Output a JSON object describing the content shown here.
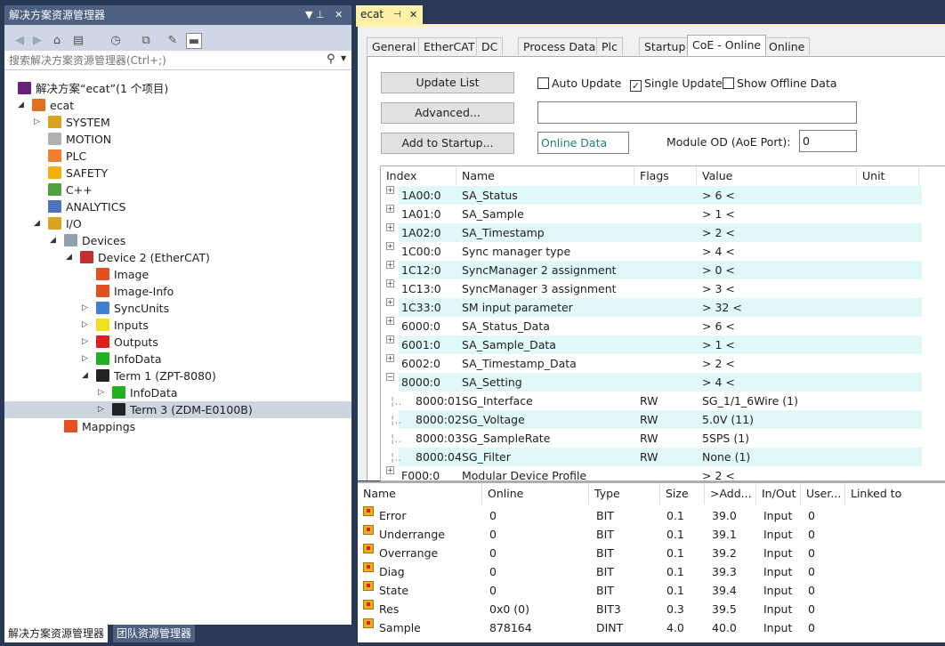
{
  "solution_explorer": {
    "title": "解决方案资源管理器",
    "title_pin": "▼ ⊥",
    "title_close": "✕",
    "search_placeholder": "搜索解决方案资源管理器(Ctrl+;)",
    "search_icon": "search-icon",
    "tree": {
      "solution": "解决方案“ecat”(1 个项目)",
      "project": "ecat",
      "system": "SYSTEM",
      "motion": "MOTION",
      "plc": "PLC",
      "safety": "SAFETY",
      "cpp": "C++",
      "analytics": "ANALYTICS",
      "io": "I/O",
      "devices": "Devices",
      "device2": "Device 2 (EtherCAT)",
      "image": "Image",
      "image_info": "Image-Info",
      "syncunits": "SyncUnits",
      "inputs": "Inputs",
      "outputs": "Outputs",
      "infodata": "InfoData",
      "term1": "Term 1 (ZPT-8080)",
      "term1_infodata": "InfoData",
      "term3": "Term 3 (ZDM-E0100B)",
      "mappings": "Mappings"
    },
    "bottom_tabs": [
      "解决方案资源管理器",
      "团队资源管理器"
    ]
  },
  "document": {
    "tab_label": "ecat",
    "tab_pin": "⊣",
    "tab_close": "✕",
    "tabs": [
      "General",
      "EtherCAT",
      "DC",
      "Process Data",
      "Plc",
      "Startup",
      "CoE - Online",
      "Online"
    ],
    "active_tab": "CoE - Online",
    "buttons": {
      "update_list": "Update List",
      "advanced": "Advanced...",
      "add_to_startup": "Add to Startup..."
    },
    "checkboxes": {
      "auto_update": "Auto Update",
      "single_update": "Single Update",
      "show_offline": "Show Offline Data",
      "auto_update_checked": false,
      "single_update_checked": true,
      "show_offline_checked": false,
      "check_mark": "✓"
    },
    "online_data_label": "Online Data",
    "module_od_label": "Module OD (AoE Port):",
    "module_od_value": "0",
    "od_columns": [
      "Index",
      "Name",
      "Flags",
      "Value",
      "Unit"
    ],
    "od_rows": [
      {
        "exp": "+",
        "index": "1A00:0",
        "name": "SA_Status",
        "flags": "",
        "value": "> 6 <"
      },
      {
        "exp": "+",
        "index": "1A01:0",
        "name": "SA_Sample",
        "flags": "",
        "value": "> 1 <"
      },
      {
        "exp": "+",
        "index": "1A02:0",
        "name": "SA_Timestamp",
        "flags": "",
        "value": "> 2 <"
      },
      {
        "exp": "+",
        "index": "1C00:0",
        "name": "Sync manager type",
        "flags": "",
        "value": "> 4 <"
      },
      {
        "exp": "+",
        "index": "1C12:0",
        "name": "SyncManager 2 assignment",
        "flags": "",
        "value": "> 0 <"
      },
      {
        "exp": "+",
        "index": "1C13:0",
        "name": "SyncManager 3 assignment",
        "flags": "",
        "value": "> 3 <"
      },
      {
        "exp": "+",
        "index": "1C33:0",
        "name": "SM input parameter",
        "flags": "",
        "value": "> 32 <"
      },
      {
        "exp": "+",
        "index": "6000:0",
        "name": "SA_Status_Data",
        "flags": "",
        "value": "> 6 <"
      },
      {
        "exp": "+",
        "index": "6001:0",
        "name": "SA_Sample_Data",
        "flags": "",
        "value": "> 1 <"
      },
      {
        "exp": "+",
        "index": "6002:0",
        "name": "SA_Timestamp_Data",
        "flags": "",
        "value": "> 2 <"
      },
      {
        "exp": "−",
        "index": "8000:0",
        "name": "SA_Setting",
        "flags": "",
        "value": "> 4 <"
      },
      {
        "exp": "",
        "index": "8000:01",
        "name": "SG_Interface",
        "flags": "RW",
        "value": "SG_1/1_6Wire (1)"
      },
      {
        "exp": "",
        "index": "8000:02",
        "name": "SG_Voltage",
        "flags": "RW",
        "value": "5.0V (11)"
      },
      {
        "exp": "",
        "index": "8000:03",
        "name": "SG_SampleRate",
        "flags": "RW",
        "value": "5SPS (1)"
      },
      {
        "exp": "",
        "index": "8000:04",
        "name": "SG_Filter",
        "flags": "RW",
        "value": "None (1)"
      },
      {
        "exp": "+",
        "index": "F000:0",
        "name": "Modular Device Profile",
        "flags": "",
        "value": "> 2 <"
      }
    ]
  },
  "variables": {
    "columns": [
      "Name",
      "Online",
      "Type",
      "Size",
      ">Add...",
      "In/Out",
      "User...",
      "Linked to"
    ],
    "rows": [
      {
        "name": "Error",
        "online": "0",
        "type": "BIT",
        "size": "0.1",
        "addr": "39.0",
        "inout": "Input",
        "user": "0"
      },
      {
        "name": "Underrange",
        "online": "0",
        "type": "BIT",
        "size": "0.1",
        "addr": "39.1",
        "inout": "Input",
        "user": "0"
      },
      {
        "name": "Overrange",
        "online": "0",
        "type": "BIT",
        "size": "0.1",
        "addr": "39.2",
        "inout": "Input",
        "user": "0"
      },
      {
        "name": "Diag",
        "online": "0",
        "type": "BIT",
        "size": "0.1",
        "addr": "39.3",
        "inout": "Input",
        "user": "0"
      },
      {
        "name": "State",
        "online": "0",
        "type": "BIT",
        "size": "0.1",
        "addr": "39.4",
        "inout": "Input",
        "user": "0"
      },
      {
        "name": "Res",
        "online": "0x0 (0)",
        "type": "BIT3",
        "size": "0.3",
        "addr": "39.5",
        "inout": "Input",
        "user": "0"
      },
      {
        "name": "Sample",
        "online": "878164",
        "type": "DINT",
        "size": "4.0",
        "addr": "40.0",
        "inout": "Input",
        "user": "0"
      }
    ]
  }
}
